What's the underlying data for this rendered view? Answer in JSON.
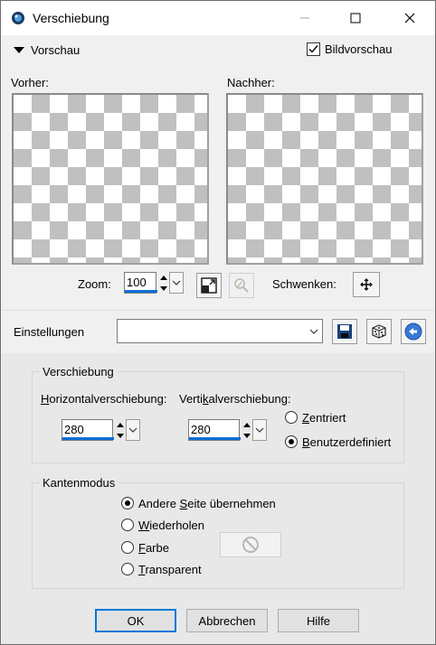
{
  "window": {
    "title": "Verschiebung",
    "minimize_icon": "minimize-icon",
    "maximize_icon": "maximize-icon",
    "close_icon": "close-icon"
  },
  "preview": {
    "section_label": "Vorschau",
    "checkbox_label": "Bildvorschau",
    "checkbox_checked": true,
    "before_label": "Vorher:",
    "after_label": "Nachher:",
    "zoom_label": "Zoom:",
    "zoom_value": "100",
    "pan_label": "Schwenken:"
  },
  "settings": {
    "label": "Einstellungen",
    "preset_value": ""
  },
  "shift_group": {
    "title": "Verschiebung",
    "horizontal_label_u": "H",
    "horizontal_label_rest": "orizontalverschiebung:",
    "horizontal_value": "280",
    "vertical_label_pre": "Verti",
    "vertical_label_u": "k",
    "vertical_label_rest": "alverschiebung:",
    "vertical_value": "280",
    "centered_label_u": "Z",
    "centered_label_rest": "entriert",
    "custom_label_u": "B",
    "custom_label_rest": "enutzerdefiniert",
    "selected": "custom"
  },
  "edge_group": {
    "title": "Kantenmodus",
    "options": [
      {
        "pre": "Andere ",
        "u": "S",
        "rest": "eite übernehmen",
        "checked": true
      },
      {
        "pre": "",
        "u": "W",
        "rest": "iederholen",
        "checked": false
      },
      {
        "pre": "",
        "u": "F",
        "rest": "arbe",
        "checked": false
      },
      {
        "pre": "",
        "u": "T",
        "rest": "ransparent",
        "checked": false
      }
    ]
  },
  "buttons": {
    "ok": "OK",
    "cancel": "Abbrechen",
    "help": "Hilfe"
  },
  "colors": {
    "accent": "#0078d7",
    "checker": "#c0c0c0"
  }
}
